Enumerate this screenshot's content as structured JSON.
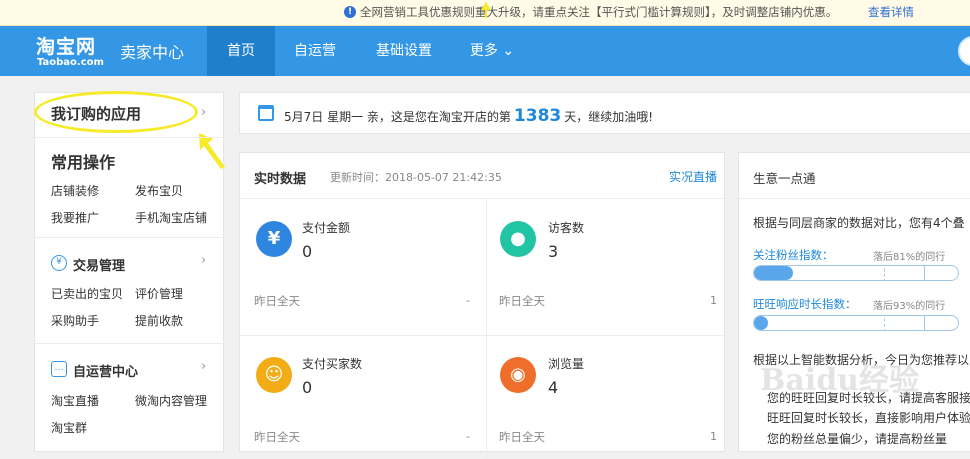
{
  "notice": {
    "text": "全网营销工具优惠规则重大升级，请重点关注【平行式门槛计算规则】，及时调整店铺内优惠。",
    "link": "查看详情"
  },
  "header": {
    "logo_cn": "淘宝网",
    "logo_en": "Taobao.com",
    "center": "卖家中心",
    "nav": [
      "首页",
      "自运营",
      "基础设置",
      "更多 ⌄"
    ]
  },
  "sidebar": {
    "subscribed": "我订购的应用",
    "common_title": "常用操作",
    "common_links": [
      "店铺装修",
      "发布宝贝",
      "我要推广",
      "手机淘宝店铺"
    ],
    "trade_title": "交易管理",
    "trade_links": [
      "已卖出的宝贝",
      "评价管理",
      "采购助手",
      "提前收款"
    ],
    "ops_title": "自运营中心",
    "ops_links": [
      "淘宝直播",
      "微淘内容管理",
      "淘宝群"
    ]
  },
  "datebar": {
    "prefix": "5月7日 星期一  亲，这是您在淘宝开店的第",
    "days": "1383",
    "suffix": "天，继续加油哦!"
  },
  "realtime": {
    "title": "实时数据",
    "updated": "更新时间：2018-05-07 21:42:35",
    "live_link": "实况直播",
    "metrics": [
      {
        "label": "支付金额",
        "value": "0",
        "yesterday": "昨日全天",
        "yesterday_value": "-"
      },
      {
        "label": "访客数",
        "value": "3",
        "yesterday": "昨日全天",
        "yesterday_value": "1"
      },
      {
        "label": "支付买家数",
        "value": "0",
        "yesterday": "昨日全天",
        "yesterday_value": "-"
      },
      {
        "label": "浏览量",
        "value": "4",
        "yesterday": "昨日全天",
        "yesterday_value": "1"
      }
    ]
  },
  "business": {
    "title": "生意一点通",
    "intro": "根据与同层商家的数据对比，您有4个叠",
    "indices": [
      {
        "name": "关注粉丝指数：",
        "lag": "落后81%的同行",
        "level": 0.19
      },
      {
        "name": "旺旺响应时长指数：",
        "lag": "落后93%的同行",
        "level": 0.07
      }
    ],
    "analysis": "根据以上智能数据分析，今日为您推荐以",
    "tips": [
      "您的旺旺回复时长较长，请提高客服接",
      "旺旺回复时长较长，直接影响用户体验",
      "您的粉丝总量偏少，请提高粉丝量"
    ]
  },
  "watermark": "Baidu经验",
  "colors": {
    "brand": "#3497e5",
    "nav_active": "#1f7fcb",
    "link": "#1f88d8",
    "highlight": "#f7ea2a"
  },
  "icons": [
    "info-icon",
    "calendar-icon",
    "yuan-icon",
    "chevron-right-icon",
    "chat-icon",
    "footprint-icon",
    "user-icon",
    "eye-icon"
  ]
}
